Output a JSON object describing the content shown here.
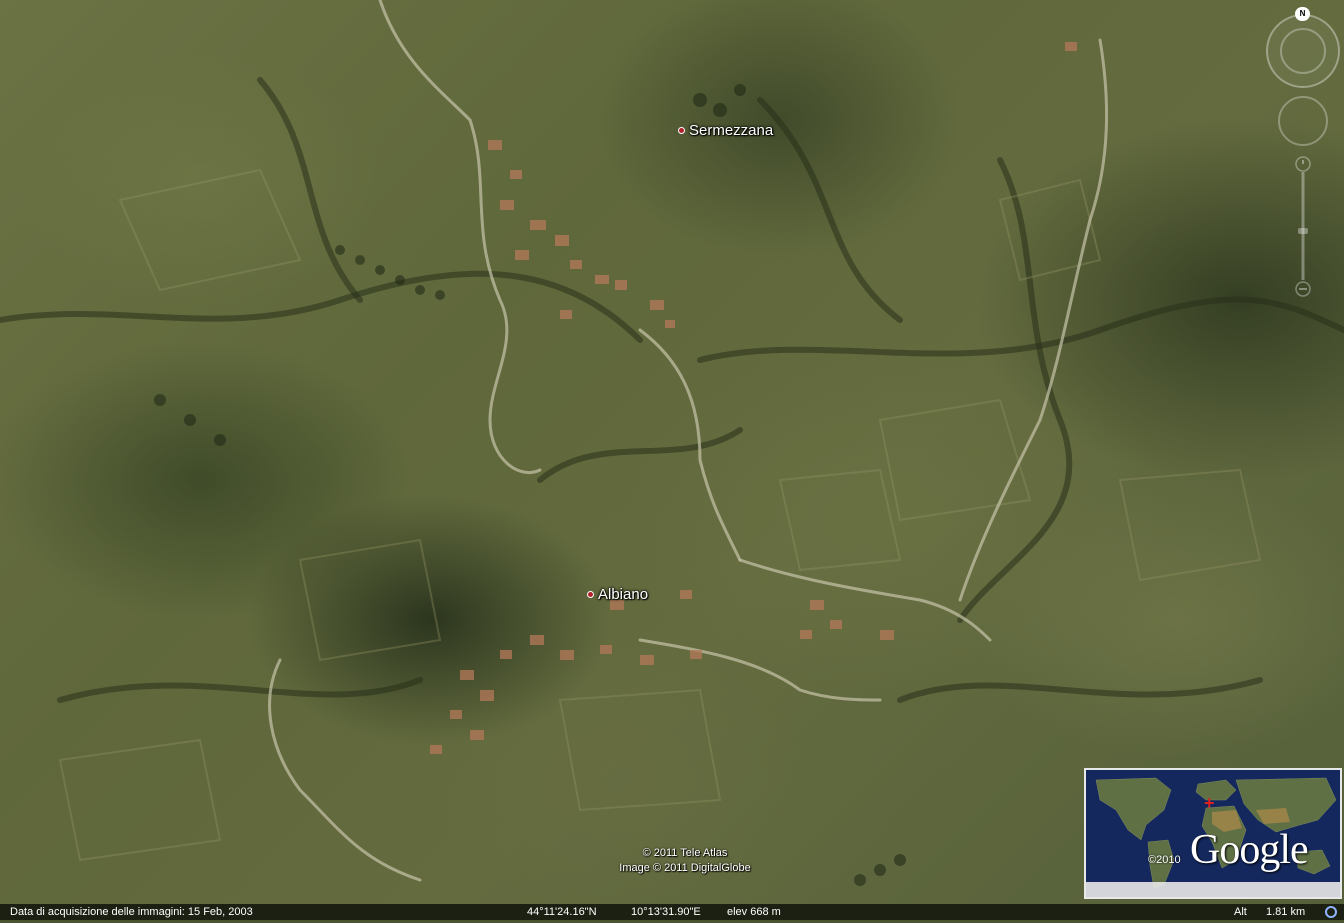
{
  "map": {
    "places": [
      {
        "name": "Sermezzana"
      },
      {
        "name": "Albiano"
      }
    ],
    "copyright_lines": [
      "© 2011 Tele Atlas",
      "Image © 2011 DigitalGlobe"
    ]
  },
  "status_bar": {
    "acquisition": "Data di acquisizione delle immagini: 15 Feb, 2003",
    "latitude": "44°11'24.16\"N",
    "longitude": "10°13'31.90\"E",
    "elevation": "elev  668 m",
    "altitude_label": "Alt",
    "altitude_value": "1.81 km"
  },
  "navigation": {
    "north_label": "N",
    "icons": [
      "compass-icon",
      "look-joystick-icon",
      "zoom-slider-icon"
    ]
  },
  "overview_map": {
    "logo": "Google",
    "year": "©2010"
  },
  "colors": {
    "terrain": "#5f683b",
    "place_dot": "#b0202a",
    "overview_ocean": "#14285e"
  }
}
